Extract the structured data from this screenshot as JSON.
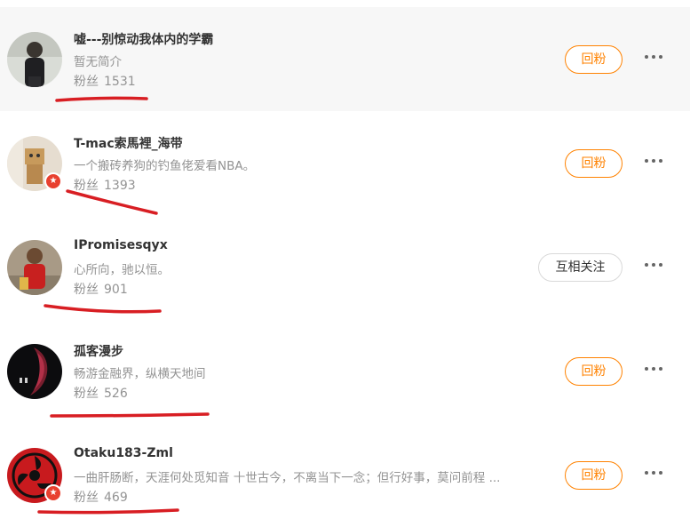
{
  "fans_label": "粉丝",
  "rows": [
    {
      "username": "嘘---别惊动我体内的学霸",
      "bio": "暂无简介",
      "fans": "1531",
      "button": "回粉",
      "verified": false
    },
    {
      "username": "T-mac索馬裡_海带",
      "bio": "一个搬砖养狗的钓鱼佬爱看NBA。",
      "fans": "1393",
      "button": "回粉",
      "verified": true
    },
    {
      "username": "IPromisesqyx",
      "bio": "心所向，驰以恒。",
      "fans": "901",
      "button": "互相关注",
      "verified": false
    },
    {
      "username": "孤客漫步",
      "bio": "畅游金融界，纵横天地间",
      "fans": "526",
      "button": "回粉",
      "verified": false
    },
    {
      "username": "Otaku183-Zml",
      "bio": "一曲肝肠断，天涯何处觅知音 十世古今，不离当下一念；但行好事，莫问前程 ...",
      "fans": "469",
      "button": "回粉",
      "verified": true
    }
  ],
  "icons": {
    "more": "more-dots-icon",
    "verified": "verified-badge-icon"
  },
  "colors": {
    "accent": "#ff8200",
    "annotation": "#d81e23",
    "muted": "#939393"
  }
}
